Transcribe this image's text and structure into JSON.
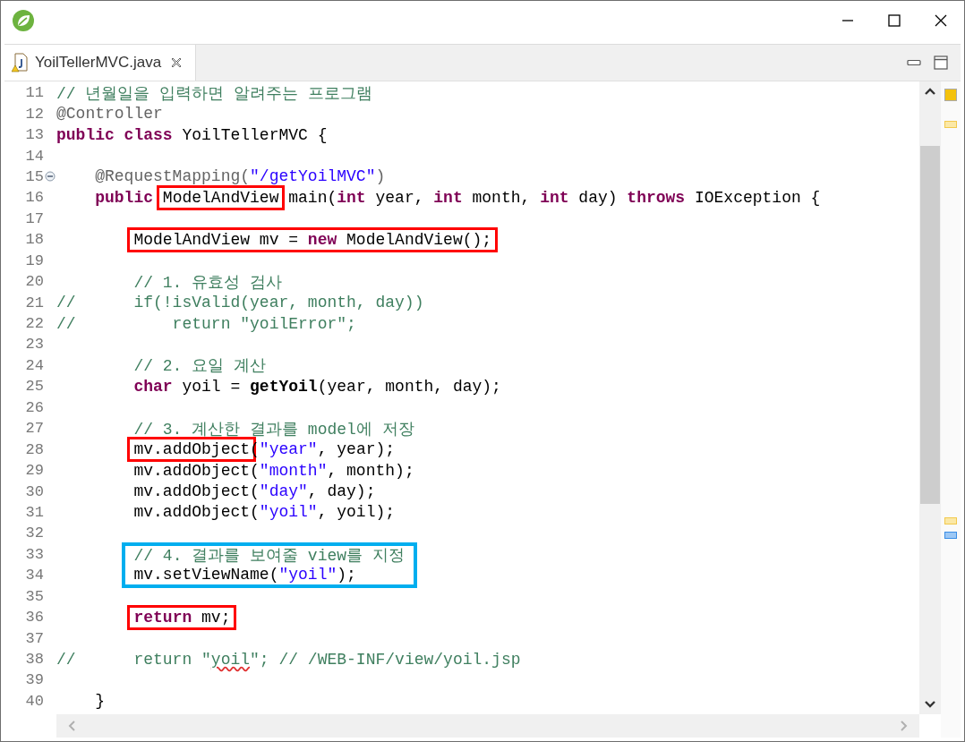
{
  "tab": {
    "label": "YoilTellerMVC.java",
    "selected": true
  },
  "code": [
    {
      "kind": "line",
      "number": "11",
      "tokens": [
        {
          "text": "// 년월일을 입력하면 알려주는 프로그램",
          "kind": "comment"
        }
      ]
    },
    {
      "kind": "line",
      "number": "12",
      "tokens": [
        {
          "text": "@Controller",
          "kind": "annotation"
        }
      ]
    },
    {
      "kind": "line",
      "number": "13",
      "tokens": [
        {
          "text": "public class",
          "kind": "keyword"
        },
        {
          "text": " YoilTellerMVC {",
          "kind": "plain"
        }
      ]
    },
    {
      "kind": "line",
      "number": "14"
    },
    {
      "kind": "line",
      "number": "15",
      "foldable": true,
      "tokens": [
        {
          "text": "    @RequestMapping(",
          "kind": "annotation"
        },
        {
          "text": "\"/getYoilMVC\"",
          "kind": "string"
        },
        {
          "text": ")",
          "kind": "annotation"
        }
      ]
    },
    {
      "kind": "line",
      "number": "16",
      "tokens": [
        {
          "text": "    public ",
          "kind": "keyword"
        },
        {
          "kind": "frame",
          "color": "#ff0000",
          "tokens": [
            {
              "text": "ModelAndView",
              "kind": "plain"
            }
          ]
        },
        {
          "text": " main(",
          "kind": "plain"
        },
        {
          "text": "int",
          "kind": "keyword"
        },
        {
          "text": " year, ",
          "kind": "plain"
        },
        {
          "text": "int",
          "kind": "keyword"
        },
        {
          "text": " month, ",
          "kind": "plain"
        },
        {
          "text": "int",
          "kind": "keyword"
        },
        {
          "text": " day) ",
          "kind": "plain"
        },
        {
          "text": "throws",
          "kind": "keyword"
        },
        {
          "text": " IOException {",
          "kind": "plain"
        }
      ]
    },
    {
      "kind": "line",
      "number": "17"
    },
    {
      "kind": "line",
      "number": "18",
      "tokens": [
        {
          "kind": "frame",
          "color": "#ff0000",
          "tokens": [
            {
              "text": "        ModelAndView mv = ",
              "kind": "plain"
            },
            {
              "text": "new",
              "kind": "keyword"
            },
            {
              "text": " ModelAndView();",
              "kind": "plain"
            }
          ]
        }
      ]
    },
    {
      "kind": "line",
      "number": "19"
    },
    {
      "kind": "line",
      "number": "20",
      "tokens": [
        {
          "text": "        // 1. 유효성 검사",
          "kind": "comment"
        }
      ]
    },
    {
      "kind": "line",
      "number": "21",
      "tokens": [
        {
          "text": "//      if(!isValid(year, month, day))",
          "kind": "comment"
        }
      ]
    },
    {
      "kind": "line",
      "number": "22",
      "tokens": [
        {
          "text": "//          return \"yoilError\";",
          "kind": "comment"
        }
      ]
    },
    {
      "kind": "line",
      "number": "23"
    },
    {
      "kind": "line",
      "number": "24",
      "tokens": [
        {
          "text": "        // 2. 요일 계산",
          "kind": "comment"
        }
      ]
    },
    {
      "kind": "line",
      "number": "25",
      "tokens": [
        {
          "text": "        char",
          "kind": "keyword"
        },
        {
          "text": " yoil = ",
          "kind": "plain"
        },
        {
          "text": "getYoil",
          "kind": "method"
        },
        {
          "text": "(year, month, day);",
          "kind": "plain"
        }
      ]
    },
    {
      "kind": "line",
      "number": "26"
    },
    {
      "kind": "line",
      "number": "27",
      "tokens": [
        {
          "text": "        // 3. 계산한 결과를 model에 저장",
          "kind": "comment"
        }
      ]
    },
    {
      "kind": "line",
      "number": "28",
      "tokens": [
        {
          "kind": "frame",
          "color": "#ff0000",
          "tokens": [
            {
              "text": "        mv.addObject",
              "kind": "plain"
            }
          ]
        },
        {
          "text": "(",
          "kind": "plain"
        },
        {
          "text": "\"year\"",
          "kind": "string"
        },
        {
          "text": ", year);",
          "kind": "plain"
        }
      ]
    },
    {
      "kind": "line",
      "number": "29",
      "tokens": [
        {
          "text": "        mv.addObject(",
          "kind": "plain"
        },
        {
          "text": "\"month\"",
          "kind": "string"
        },
        {
          "text": ", month);",
          "kind": "plain"
        }
      ]
    },
    {
      "kind": "line",
      "number": "30",
      "tokens": [
        {
          "text": "        mv.addObject(",
          "kind": "plain"
        },
        {
          "text": "\"day\"",
          "kind": "string"
        },
        {
          "text": ", day);",
          "kind": "plain"
        }
      ]
    },
    {
      "kind": "line",
      "number": "31",
      "tokens": [
        {
          "text": "        mv.addObject(",
          "kind": "plain"
        },
        {
          "text": "\"yoil\"",
          "kind": "string"
        },
        {
          "text": ", yoil);",
          "kind": "plain"
        }
      ]
    },
    {
      "kind": "line",
      "number": "32"
    },
    {
      "kind": "group",
      "color": "#00aeef",
      "lines": [
        {
          "number": "33",
          "tokens": [
            {
              "text": "        // 4. 결과를 보여줄 view를 지정",
              "kind": "comment"
            }
          ]
        },
        {
          "number": "34",
          "tokens": [
            {
              "text": "        mv.setViewName(",
              "kind": "plain"
            },
            {
              "text": "\"yoil\"",
              "kind": "string"
            },
            {
              "text": ");",
              "kind": "plain"
            }
          ]
        }
      ]
    },
    {
      "kind": "line",
      "number": "35"
    },
    {
      "kind": "line",
      "number": "36",
      "tokens": [
        {
          "kind": "frame",
          "color": "#ff0000",
          "tokens": [
            {
              "text": "        return",
              "kind": "keyword"
            },
            {
              "text": " mv;",
              "kind": "plain"
            }
          ]
        }
      ]
    },
    {
      "kind": "line",
      "number": "37"
    },
    {
      "kind": "line",
      "number": "38",
      "tokens": [
        {
          "text": "//      return \"",
          "kind": "comment"
        },
        {
          "text": "yoil",
          "kind": "comment",
          "misspelled": true
        },
        {
          "text": "\"; // /WEB-INF/view/yoil.jsp",
          "kind": "comment"
        }
      ]
    },
    {
      "kind": "line",
      "number": "39"
    },
    {
      "kind": "line",
      "number": "40",
      "tokens": [
        {
          "text": "    }",
          "kind": "plain"
        }
      ]
    }
  ]
}
